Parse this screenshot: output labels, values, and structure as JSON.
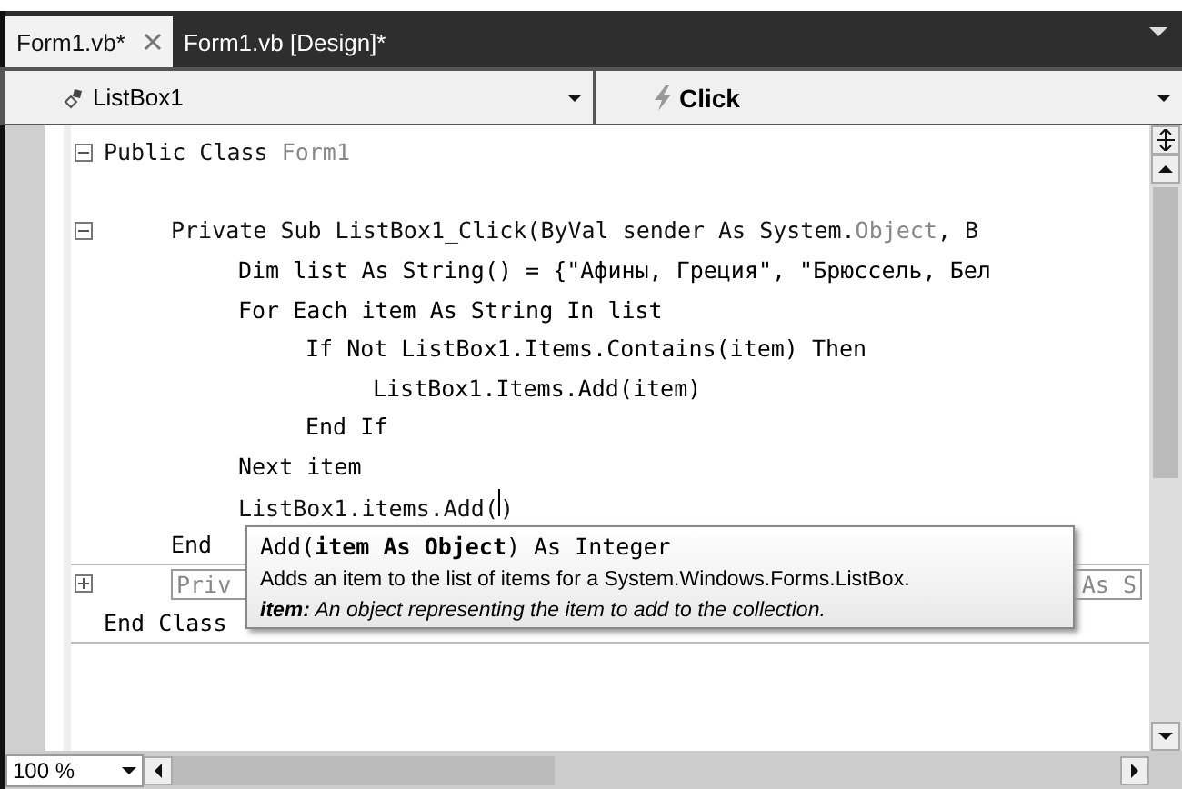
{
  "tabs": [
    {
      "label": "Form1.vb*",
      "selected": true,
      "closable": true
    },
    {
      "label": "Form1.vb [Design]*",
      "selected": false,
      "closable": false
    }
  ],
  "dropdowns": [
    {
      "kind": "object",
      "value": "ListBox1"
    },
    {
      "kind": "event",
      "value": "Click"
    }
  ],
  "code_lines": [
    {
      "collapsed": false,
      "segments": [
        {
          "text": "Public Class ",
          "kind": "plain"
        },
        {
          "text": "Form1",
          "kind": "type"
        }
      ],
      "children": [
        {
          "collapsed": false,
          "segments": [
            {
              "text": "Private Sub ListBox1_Click(ByVal sender As System.",
              "kind": "plain"
            },
            {
              "text": "Object",
              "kind": "type"
            },
            {
              "text": ", B",
              "kind": "plain"
            }
          ],
          "children": [
            {
              "text": "Dim list As String() = {\"Афины, Греция\", \"Брюссель, Бел"
            },
            {
              "text": "For Each item As String In list",
              "children": [
                {
                  "text": "If Not ListBox1.Items.Contains(item) Then",
                  "children": [
                    {
                      "text": "ListBox1.Items.Add(item)"
                    }
                  ]
                },
                {
                  "text": "End If"
                }
              ]
            },
            {
              "text": "Next item"
            },
            {
              "caret": true,
              "segments": [
                {
                  "text": "ListBox1.items.Add(",
                  "kind": "plain"
                },
                {
                  "text": ")",
                  "kind": "plain"
                }
              ]
            }
          ]
        },
        {
          "separator": true,
          "text": "End"
        },
        {
          "collapsed": true,
          "segments": [
            {
              "text": "Priv",
              "kind": "type"
            },
            {
              "text": "As S",
              "kind": "type"
            }
          ]
        }
      ]
    },
    {
      "separator": true,
      "text": "End Class"
    }
  ],
  "tooltip": {
    "signature": "Add(**item As Object**) As Integer",
    "description": "Adds an item to the list of items for a System.Windows.Forms.ListBox.",
    "param_name": "item:",
    "param_description": "An object representing the item to add to the collection."
  },
  "zoom": "100 %"
}
